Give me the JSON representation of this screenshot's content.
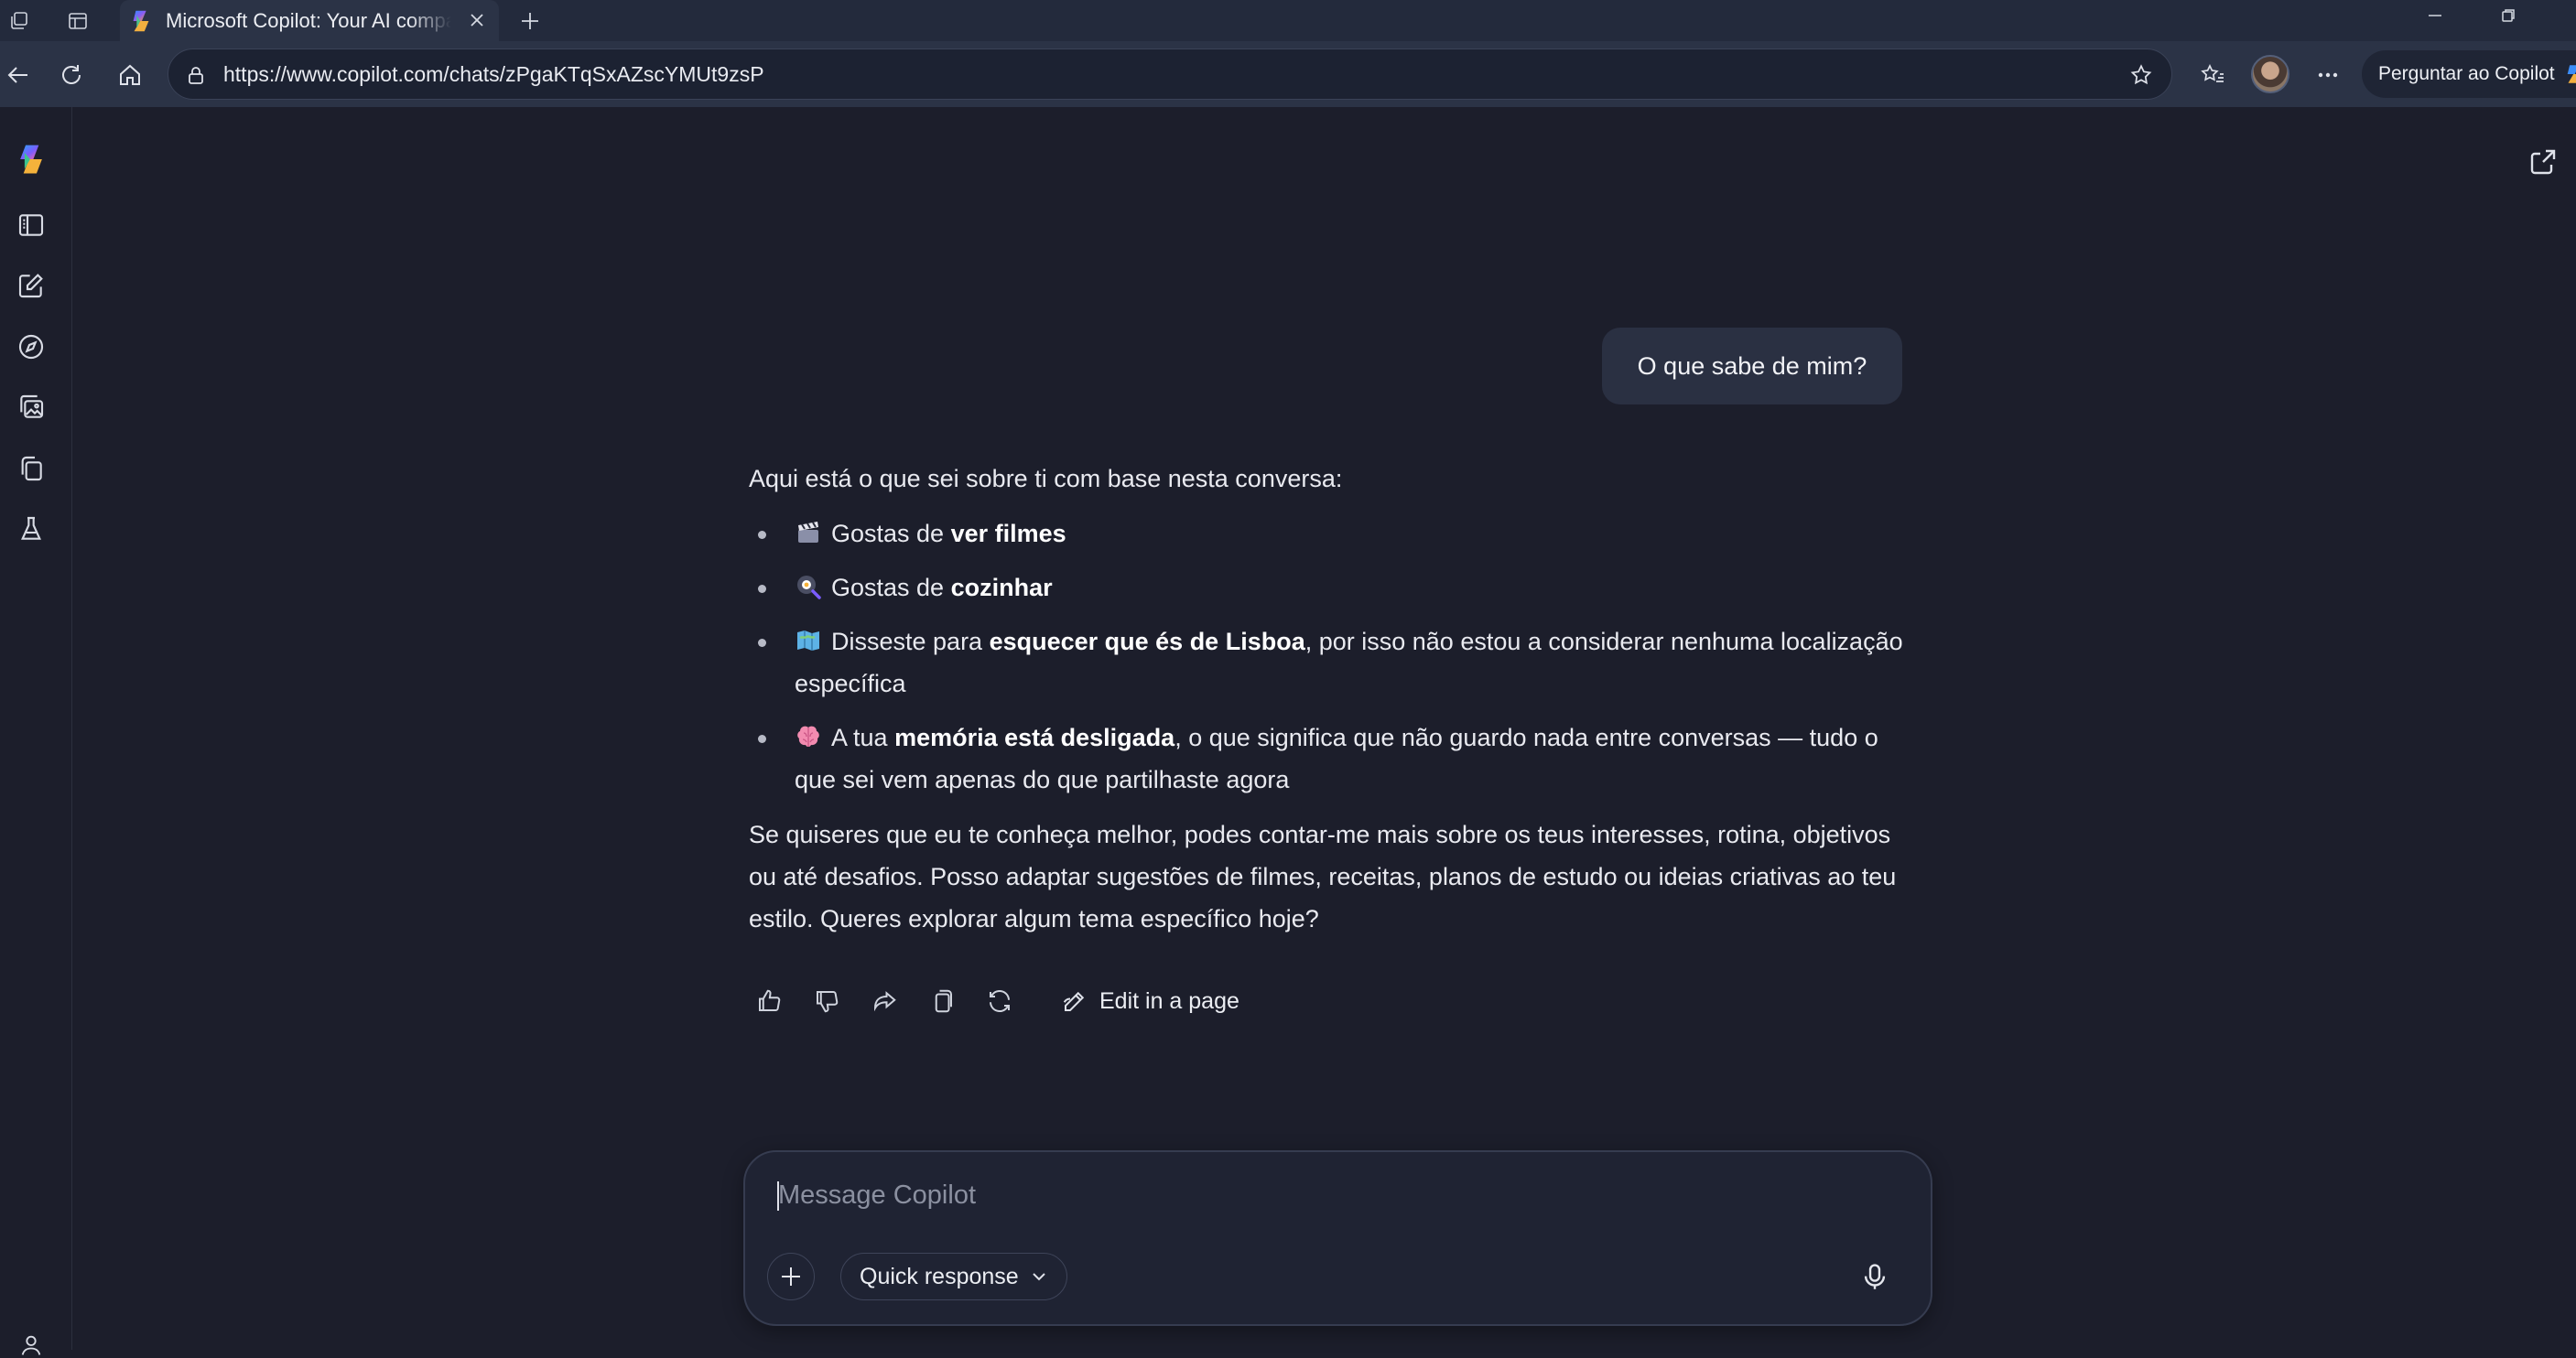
{
  "browser": {
    "tab_title": "Microsoft Copilot: Your AI companion",
    "url": "https://www.copilot.com/chats/zPgaKTqSxAZscYMUt9zsP",
    "ask_copilot_label": "Perguntar ao Copilot",
    "icons": [
      "workspaces-icon",
      "vertical-tabs-icon",
      "copilot-favicon",
      "close-icon",
      "plus-icon",
      "minimize-icon",
      "restore-icon",
      "back-icon",
      "refresh-icon",
      "home-icon",
      "lock-icon",
      "star-icon",
      "favorites-icon",
      "profile-avatar",
      "more-icon"
    ]
  },
  "sidebar": {
    "items": [
      {
        "name": "copilot-logo"
      },
      {
        "name": "sidebar-toggle-icon"
      },
      {
        "name": "new-chat-icon"
      },
      {
        "name": "discover-icon"
      },
      {
        "name": "image-gallery-icon"
      },
      {
        "name": "pages-icon"
      },
      {
        "name": "labs-icon"
      }
    ]
  },
  "chat": {
    "user_message": "O que sabe de mim?",
    "reply": {
      "intro": "Aqui está o que sei sobre ti com base nesta conversa:",
      "items": [
        {
          "emoji": "clapper-emoji",
          "pre": "Gostas de ",
          "bold": "ver filmes",
          "post": ""
        },
        {
          "emoji": "frying-pan-emoji",
          "pre": "Gostas de ",
          "bold": "cozinhar",
          "post": ""
        },
        {
          "emoji": "map-emoji",
          "pre": "Disseste para ",
          "bold": "esquecer que és de Lisboa",
          "post": ", por isso não estou a considerar nenhuma localização específica"
        },
        {
          "emoji": "brain-emoji",
          "pre": "A tua ",
          "bold": "memória está desligada",
          "post": ", o que significa que não guardo nada entre conversas — tudo o que sei vem apenas do que partilhaste agora"
        }
      ],
      "outro": "Se quiseres que eu te conheça melhor, podes contar-me mais sobre os teus interesses, rotina, objetivos ou até desafios. Posso adaptar sugestões de filmes, receitas, planos de estudo ou ideias criativas ao teu estilo. Queres explorar algum tema específico hoje?"
    },
    "actions": {
      "edit_in_page": "Edit in a page"
    }
  },
  "composer": {
    "placeholder": "Message Copilot",
    "mode_label": "Quick response"
  },
  "colors": {
    "background": "#1c1e2b",
    "chrome": "#2b3346",
    "bubble": "#2a3042"
  }
}
